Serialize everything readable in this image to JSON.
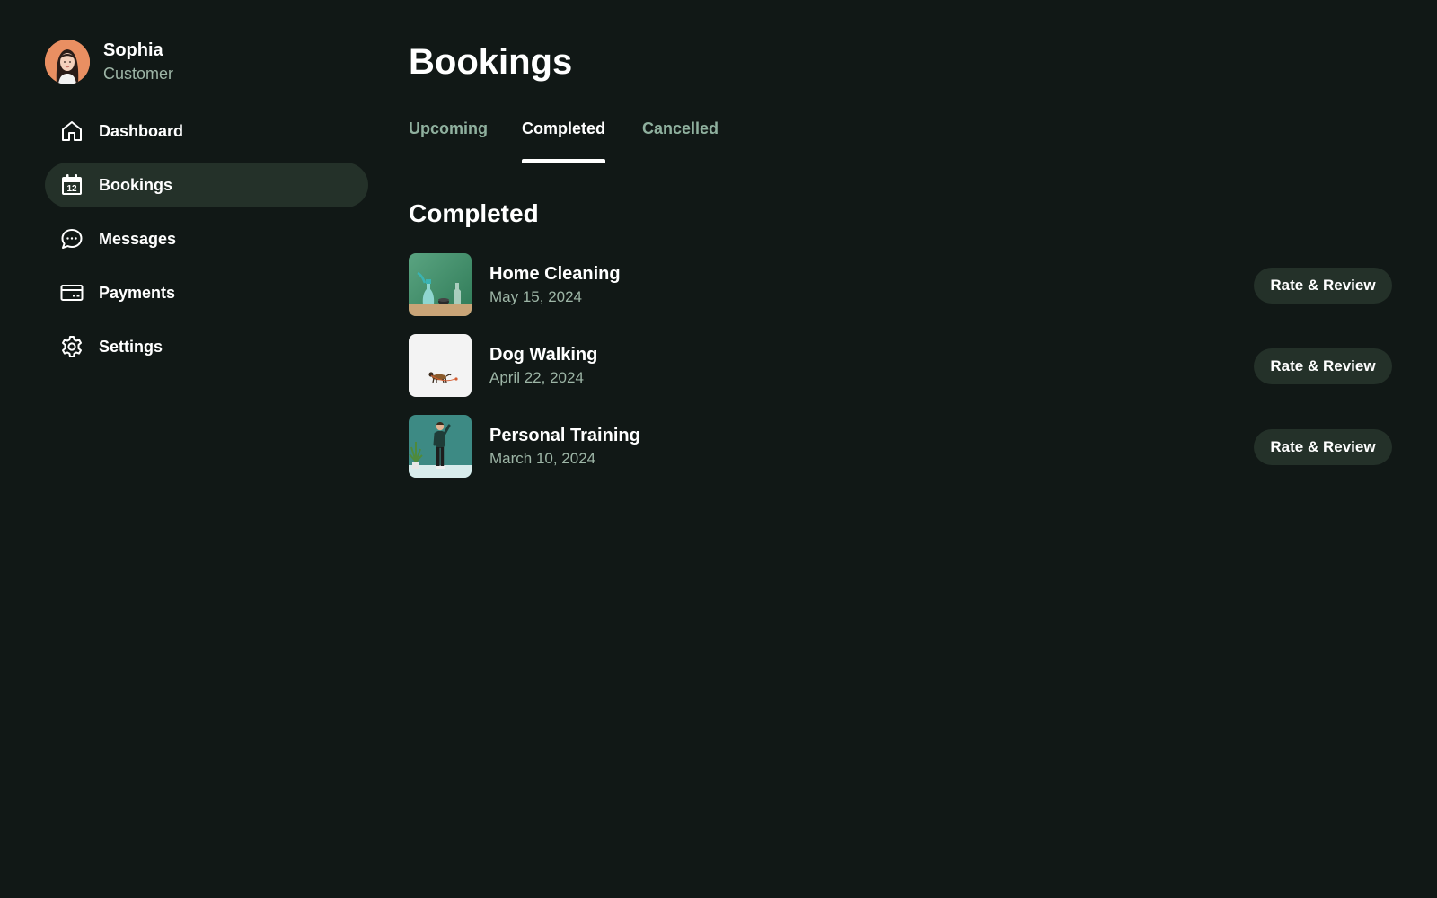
{
  "user": {
    "name": "Sophia",
    "role": "Customer"
  },
  "sidebar": {
    "items": [
      {
        "label": "Dashboard",
        "icon": "home-icon",
        "active": false
      },
      {
        "label": "Bookings",
        "icon": "calendar-icon",
        "icon_text": "12",
        "active": true
      },
      {
        "label": "Messages",
        "icon": "chat-bubble-icon",
        "active": false
      },
      {
        "label": "Payments",
        "icon": "credit-card-icon",
        "active": false
      },
      {
        "label": "Settings",
        "icon": "gear-icon",
        "active": false
      }
    ]
  },
  "page": {
    "title": "Bookings"
  },
  "tabs": [
    {
      "label": "Upcoming",
      "active": false
    },
    {
      "label": "Completed",
      "active": true
    },
    {
      "label": "Cancelled",
      "active": false
    }
  ],
  "section": {
    "title": "Completed"
  },
  "bookings": [
    {
      "title": "Home Cleaning",
      "date": "May 15, 2024",
      "action": "Rate & Review",
      "thumbnail": "cleaning-supplies-photo"
    },
    {
      "title": "Dog Walking",
      "date": "April 22, 2024",
      "action": "Rate & Review",
      "thumbnail": "dog-on-leash-photo"
    },
    {
      "title": "Personal Training",
      "date": "March 10, 2024",
      "action": "Rate & Review",
      "thumbnail": "trainer-photo"
    }
  ],
  "colors": {
    "background": "#111816",
    "active_nav": "#243129",
    "muted_text": "#9db5a6",
    "tab_inactive": "#8fb09e",
    "button_bg": "#243129"
  }
}
